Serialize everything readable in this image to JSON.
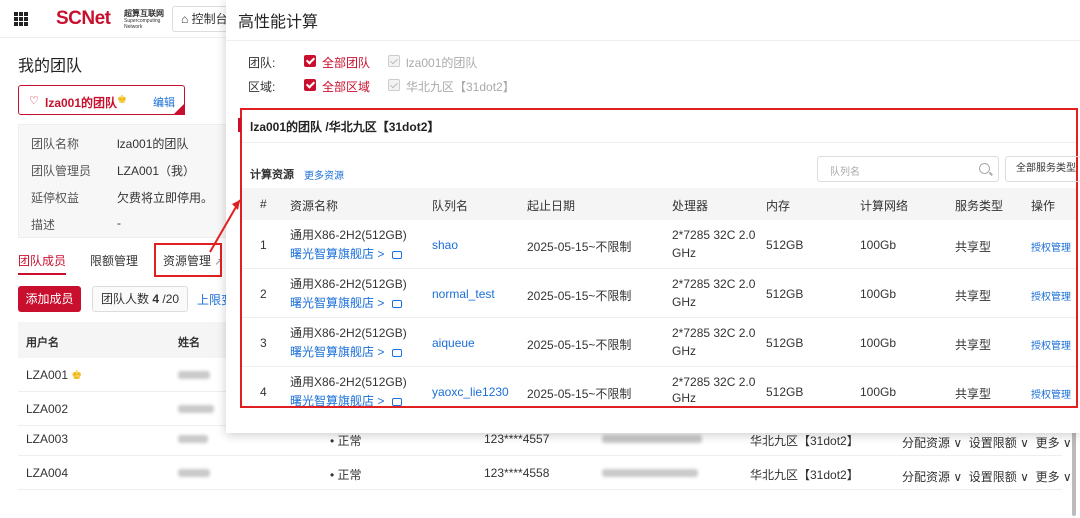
{
  "topbar": {
    "logo": "SCNet",
    "logo_sub": "超算互联网",
    "logo_sub2": "Supercomputing Network",
    "home_tab": "控制台"
  },
  "page": {
    "title": "我的团队",
    "team_card": {
      "name": "lza001的团队",
      "edit": "编辑"
    },
    "info": [
      {
        "label": "团队名称",
        "value": "lza001的团队"
      },
      {
        "label": "团队管理员",
        "value": "LZA001（我）"
      },
      {
        "label": "延停权益",
        "value": "欠费将立即停用。"
      },
      {
        "label": "描述",
        "value": "-"
      }
    ],
    "tabs": [
      "团队成员",
      "限额管理",
      "资源管理"
    ],
    "add_member": "添加成员",
    "member_count_label": "团队人数",
    "member_count": "4",
    "member_total": "/20",
    "limit_link": "上限变",
    "table_headers": [
      "用户名",
      "姓名"
    ],
    "users": [
      {
        "username": "LZA001",
        "status": "",
        "phone": "",
        "region": ""
      },
      {
        "username": "LZA002",
        "status": "",
        "phone": "",
        "region": ""
      },
      {
        "username": "LZA003",
        "status": "• 正常",
        "phone": "123****4557",
        "region": "华北九区【31dot2】"
      },
      {
        "username": "LZA004",
        "status": "• 正常",
        "phone": "123****4558",
        "region": "华北九区【31dot2】"
      }
    ],
    "row_actions": [
      "分配资源 ∨",
      "设置限额 ∨",
      "更多 ∨"
    ]
  },
  "modal": {
    "title": "高性能计算",
    "filter_team_label": "团队:",
    "filter_team_all": "全部团队",
    "filter_team_opt": "lza001的团队",
    "filter_region_label": "区域:",
    "filter_region_all": "全部区域",
    "filter_region_opt": "华北九区【31dot2】",
    "panel_title": "lza001的团队 /华北九区【31dot2】",
    "section_title": "计算资源",
    "more_resources": "更多资源",
    "search_placeholder": "队列名",
    "service_type_select": "全部服务类型",
    "headers": [
      "#",
      "资源名称",
      "队列名",
      "起止日期",
      "处理器",
      "内存",
      "计算网络",
      "服务类型",
      "操作"
    ],
    "rows": [
      {
        "idx": "1",
        "name": "通用X86-2H2(512GB)",
        "store": "曙光智算旗舰店 >",
        "queue": "shao",
        "date": "2025-05-15~不限制",
        "cpu1": "2*7285 32C 2.0",
        "cpu2": "GHz",
        "mem": "512GB",
        "net": "100Gb",
        "stype": "共享型",
        "action": "授权管理"
      },
      {
        "idx": "2",
        "name": "通用X86-2H2(512GB)",
        "store": "曙光智算旗舰店 >",
        "queue": "normal_test",
        "date": "2025-05-15~不限制",
        "cpu1": "2*7285 32C 2.0",
        "cpu2": "GHz",
        "mem": "512GB",
        "net": "100Gb",
        "stype": "共享型",
        "action": "授权管理"
      },
      {
        "idx": "3",
        "name": "通用X86-2H2(512GB)",
        "store": "曙光智算旗舰店 >",
        "queue": "aiqueue",
        "date": "2025-05-15~不限制",
        "cpu1": "2*7285 32C 2.0",
        "cpu2": "GHz",
        "mem": "512GB",
        "net": "100Gb",
        "stype": "共享型",
        "action": "授权管理"
      },
      {
        "idx": "4",
        "name": "通用X86-2H2(512GB)",
        "store": "曙光智算旗舰店 >",
        "queue": "yaoxc_lie1230",
        "date": "2025-05-15~不限制",
        "cpu1": "2*7285 32C 2.0",
        "cpu2": "GHz",
        "mem": "512GB",
        "net": "100Gb",
        "stype": "共享型",
        "action": "授权管理"
      }
    ]
  },
  "colors": {
    "brand": "#c8102e",
    "link": "#1a6fd8",
    "highlight": "#e02020"
  }
}
